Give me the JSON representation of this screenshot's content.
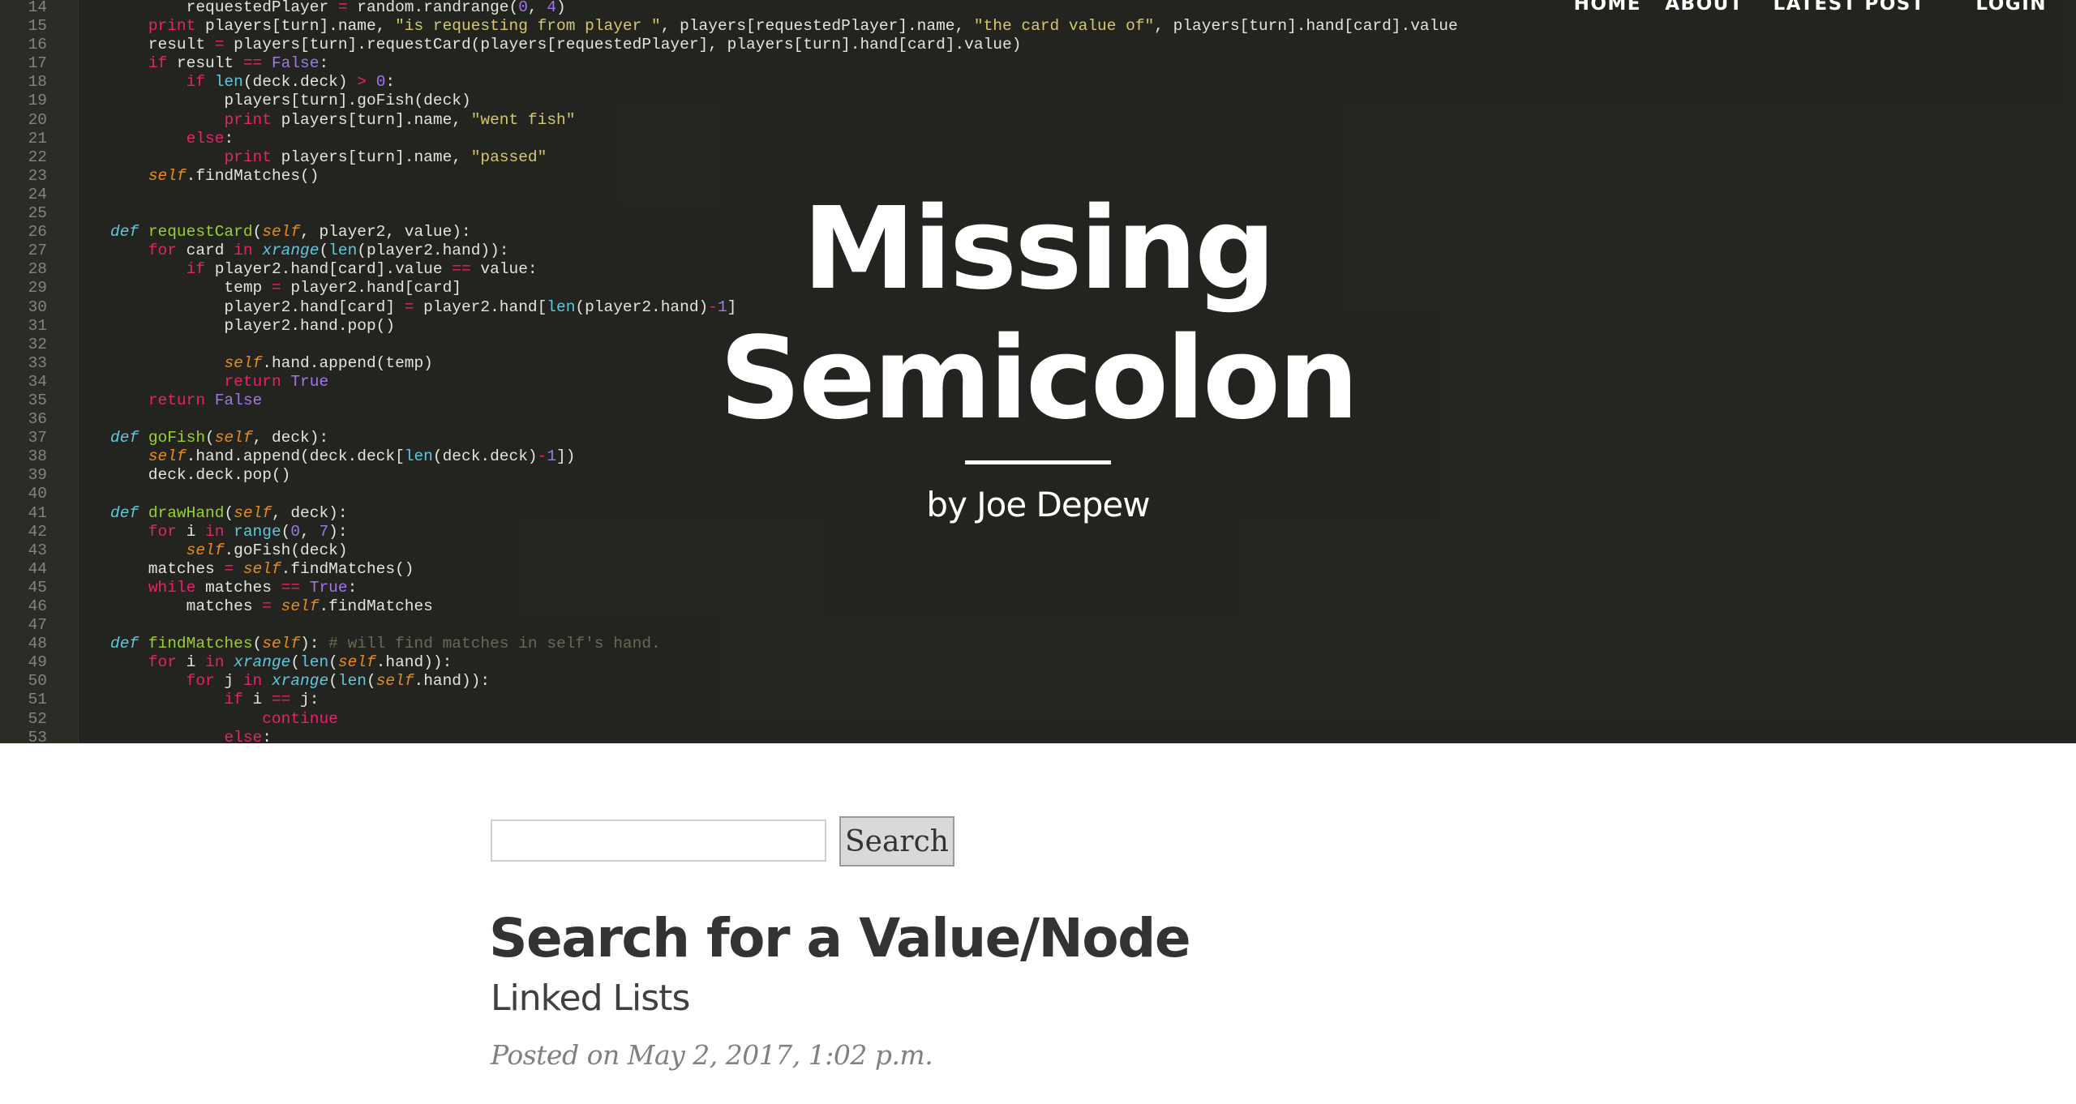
{
  "nav": {
    "items": [
      {
        "label": "HOME"
      },
      {
        "label": "ABOUT"
      },
      {
        "label": "LATEST POST"
      },
      {
        "label": "LOGIN"
      }
    ]
  },
  "hero": {
    "title_line1": "Missing",
    "title_line2": "Semicolon",
    "byline": "by Joe Depew"
  },
  "code_background": {
    "lines": [
      {
        "n": "14",
        "t": "        requestedPlayer = random.randrange(0, 4)"
      },
      {
        "n": "15",
        "t": "    print players[turn].name, \"is requesting from player \", players[requestedPlayer].name, \"the card value of\", players[turn].hand[card].value"
      },
      {
        "n": "16",
        "t": "    result = players[turn].requestCard(players[requestedPlayer], players[turn].hand[card].value)"
      },
      {
        "n": "17",
        "t": "    if result == False:"
      },
      {
        "n": "18",
        "t": "        if len(deck.deck) > 0:"
      },
      {
        "n": "19",
        "t": "            players[turn].goFish(deck)"
      },
      {
        "n": "20",
        "t": "            print players[turn].name, \"went fish\""
      },
      {
        "n": "21",
        "t": "        else:"
      },
      {
        "n": "22",
        "t": "            print players[turn].name, \"passed\""
      },
      {
        "n": "23",
        "t": "    self.findMatches()"
      },
      {
        "n": "24",
        "t": ""
      },
      {
        "n": "25",
        "t": ""
      },
      {
        "n": "26",
        "t": "def requestCard(self, player2, value):"
      },
      {
        "n": "27",
        "t": "    for card in xrange(len(player2.hand)):"
      },
      {
        "n": "28",
        "t": "        if player2.hand[card].value == value:"
      },
      {
        "n": "29",
        "t": "            temp = player2.hand[card]"
      },
      {
        "n": "30",
        "t": "            player2.hand[card] = player2.hand[len(player2.hand)-1]"
      },
      {
        "n": "31",
        "t": "            player2.hand.pop()"
      },
      {
        "n": "32",
        "t": ""
      },
      {
        "n": "33",
        "t": "            self.hand.append(temp)"
      },
      {
        "n": "34",
        "t": "            return True"
      },
      {
        "n": "35",
        "t": "    return False"
      },
      {
        "n": "36",
        "t": ""
      },
      {
        "n": "37",
        "t": "def goFish(self, deck):"
      },
      {
        "n": "38",
        "t": "    self.hand.append(deck.deck[len(deck.deck)-1])"
      },
      {
        "n": "39",
        "t": "    deck.deck.pop()"
      },
      {
        "n": "40",
        "t": ""
      },
      {
        "n": "41",
        "t": "def drawHand(self, deck):"
      },
      {
        "n": "42",
        "t": "    for i in range(0, 7):"
      },
      {
        "n": "43",
        "t": "        self.goFish(deck)"
      },
      {
        "n": "44",
        "t": "    matches = self.findMatches()"
      },
      {
        "n": "45",
        "t": "    while matches == True:"
      },
      {
        "n": "46",
        "t": "        matches = self.findMatches"
      },
      {
        "n": "47",
        "t": ""
      },
      {
        "n": "48",
        "t": "def findMatches(self): # will find matches in self's hand."
      },
      {
        "n": "49",
        "t": "    for i in xrange(len(self.hand)):"
      },
      {
        "n": "50",
        "t": "        for j in xrange(len(self.hand)):"
      },
      {
        "n": "51",
        "t": "            if i == j:"
      },
      {
        "n": "52",
        "t": "                continue"
      },
      {
        "n": "53",
        "t": "            else:"
      }
    ]
  },
  "search": {
    "placeholder": "",
    "value": "",
    "button_label": "Search"
  },
  "post": {
    "title": "Search for a Value/Node",
    "subtitle": "Linked Lists",
    "meta": "Posted on May 2, 2017, 1:02 p.m."
  }
}
